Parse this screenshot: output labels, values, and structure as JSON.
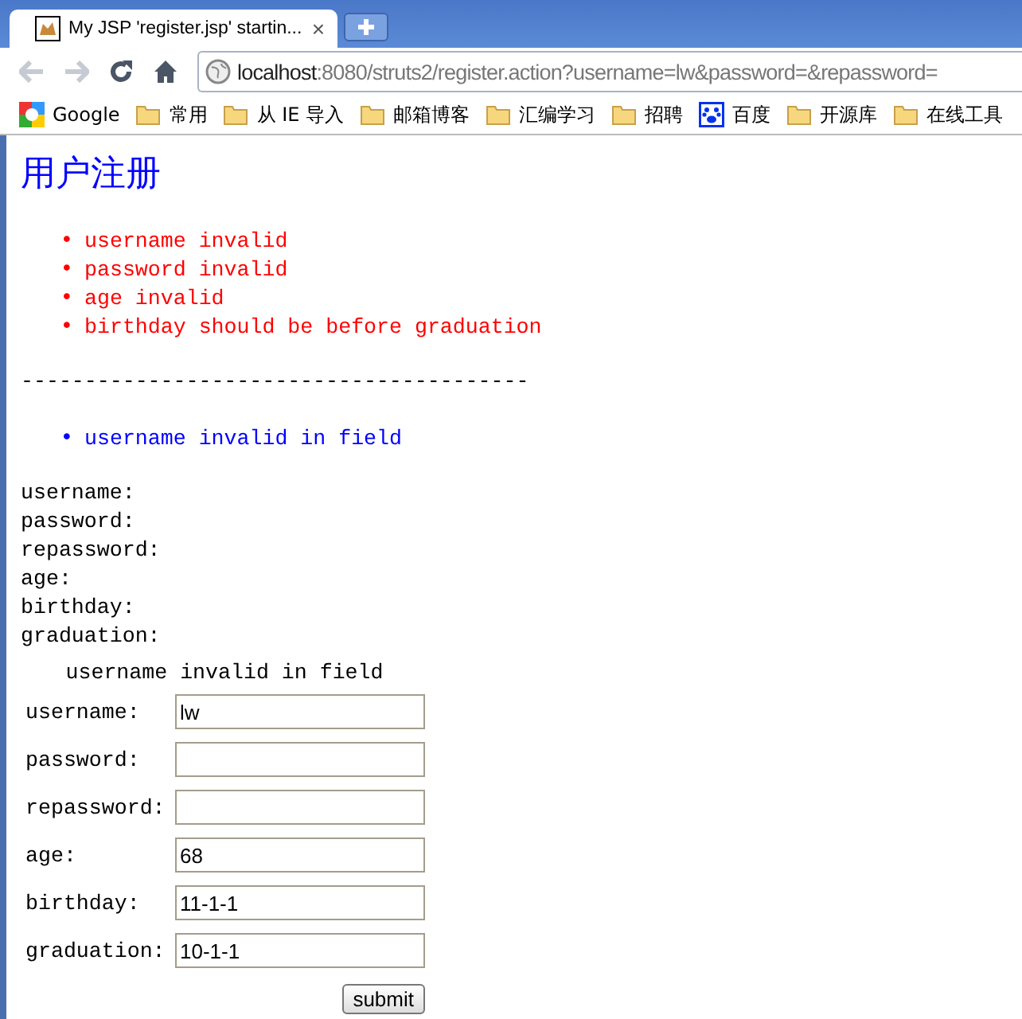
{
  "tab": {
    "title": "My JSP 'register.jsp' startin...",
    "close": "×"
  },
  "address": {
    "host": "localhost",
    "path": ":8080/struts2/register.action?username=lw&password=&repassword="
  },
  "bookmarks": [
    {
      "label": "Google",
      "kind": "google"
    },
    {
      "label": "常用",
      "kind": "folder"
    },
    {
      "label": "从 IE 导入",
      "kind": "folder"
    },
    {
      "label": "邮箱博客",
      "kind": "folder"
    },
    {
      "label": "汇编学习",
      "kind": "folder"
    },
    {
      "label": "招聘",
      "kind": "folder"
    },
    {
      "label": "百度",
      "kind": "paw"
    },
    {
      "label": "开源库",
      "kind": "folder"
    },
    {
      "label": "在线工具",
      "kind": "folder"
    }
  ],
  "page": {
    "title": "用户注册",
    "bullet": "•",
    "action_errors": [
      "username invalid",
      "password invalid",
      "age invalid",
      "birthday should be before graduation"
    ],
    "separator": "----------------------------------------",
    "field_errors": [
      "username invalid in field"
    ],
    "labels": [
      "username:",
      "password:",
      "repassword:",
      "age:",
      "birthday:",
      "graduation:"
    ],
    "form": {
      "error": "username invalid in field",
      "fields": [
        {
          "label": "username:",
          "value": "lw"
        },
        {
          "label": "password:"
        },
        {
          "label": "repassword:"
        },
        {
          "label": "age:",
          "value": "68"
        },
        {
          "label": "birthday:",
          "value": "11-1-1"
        },
        {
          "label": "graduation:",
          "value": "10-1-1"
        }
      ],
      "submit": "submit"
    }
  }
}
